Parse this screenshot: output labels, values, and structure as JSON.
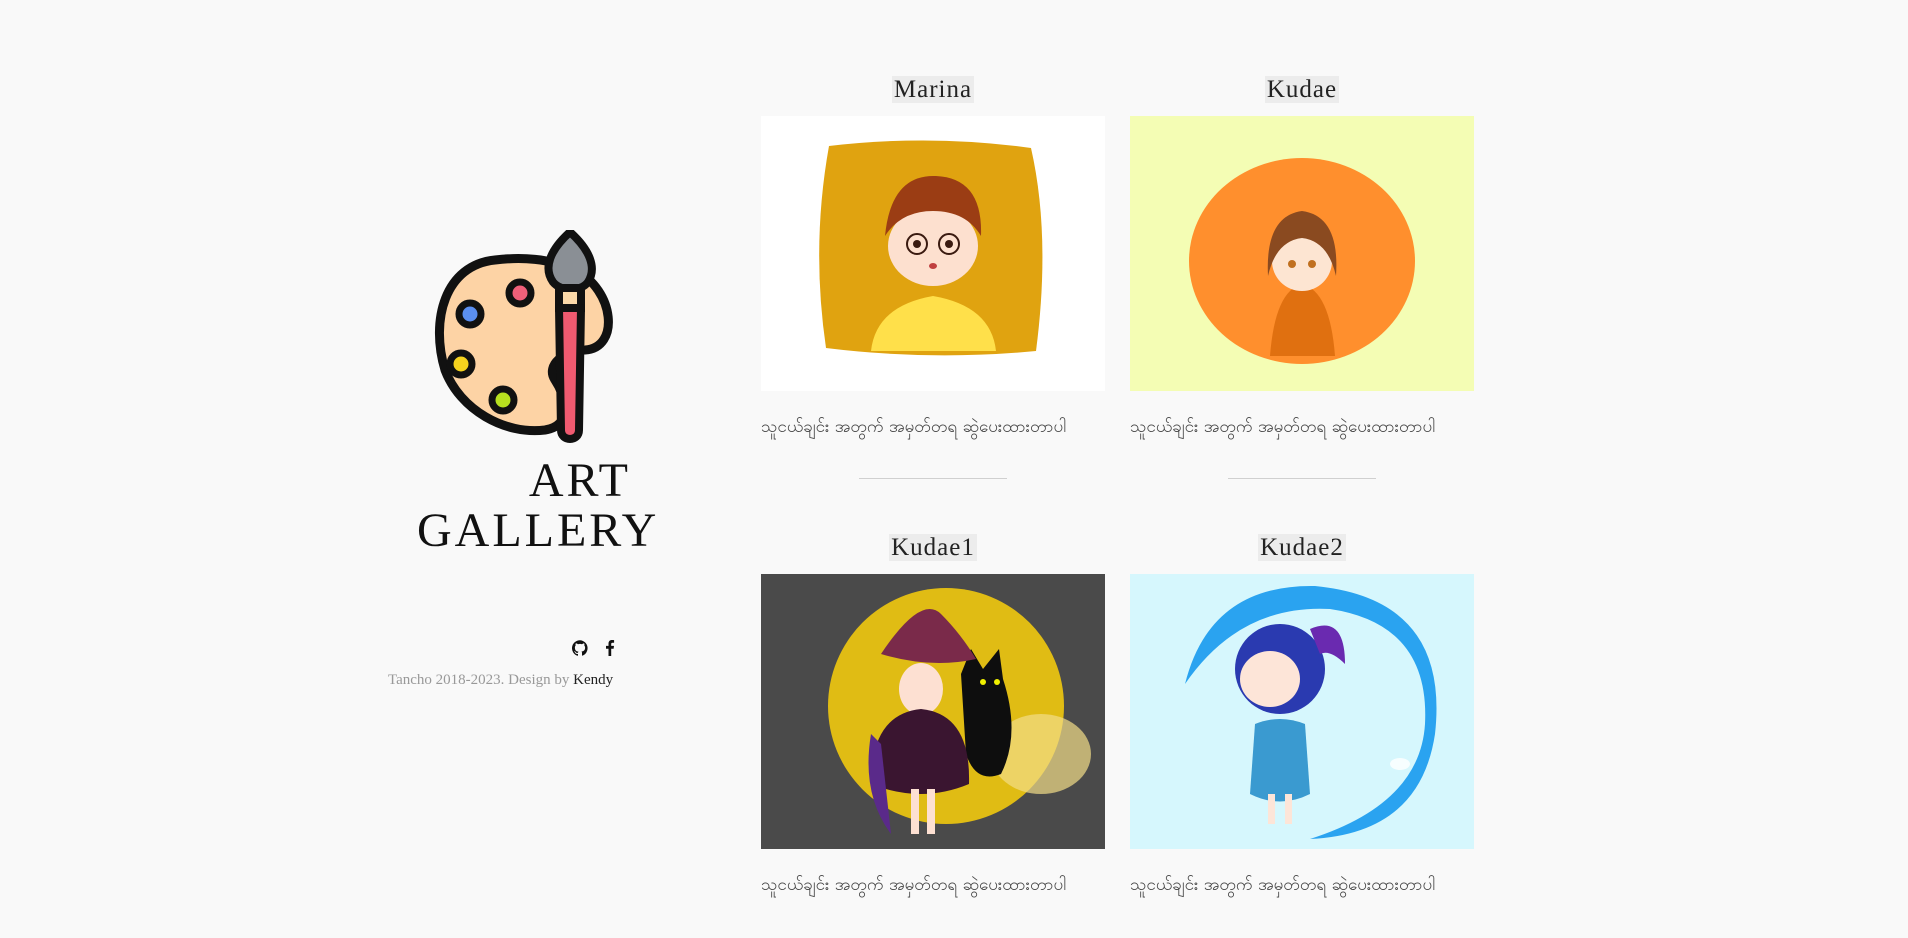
{
  "brand": {
    "line1": "ART",
    "line2": "GALLERY"
  },
  "social": [
    {
      "name": "github-icon"
    },
    {
      "name": "facebook-icon"
    }
  ],
  "footer": {
    "copyright": "Tancho 2018-2023. Design by ",
    "designer": "Kendy"
  },
  "gallery": [
    {
      "title": "Marina",
      "caption": "သူငယ်ချင်း အတွက် အမှတ်တရ ဆွဲပေးထားတာပါ",
      "bg": "#ffffff",
      "accent": "#e8a510"
    },
    {
      "title": "Kudae",
      "caption": "သူငယ်ချင်း အတွက် အမှတ်တရ ဆွဲပေးထားတာပါ",
      "bg": "#f4fdb4",
      "accent": "#ff8f2d"
    },
    {
      "title": "Kudae1",
      "caption": "သူငယ်ချင်း အတွက် အမှတ်တရ ဆွဲပေးထားတာပါ",
      "bg": "#4a4a4a",
      "accent": "#e9c414"
    },
    {
      "title": "Kudae2",
      "caption": "သူငယ်ချင်း အတွက် အမှတ်တရ ဆွဲပေးထားတာပါ",
      "bg": "#d6f7fd",
      "accent": "#2aa3f0"
    }
  ]
}
